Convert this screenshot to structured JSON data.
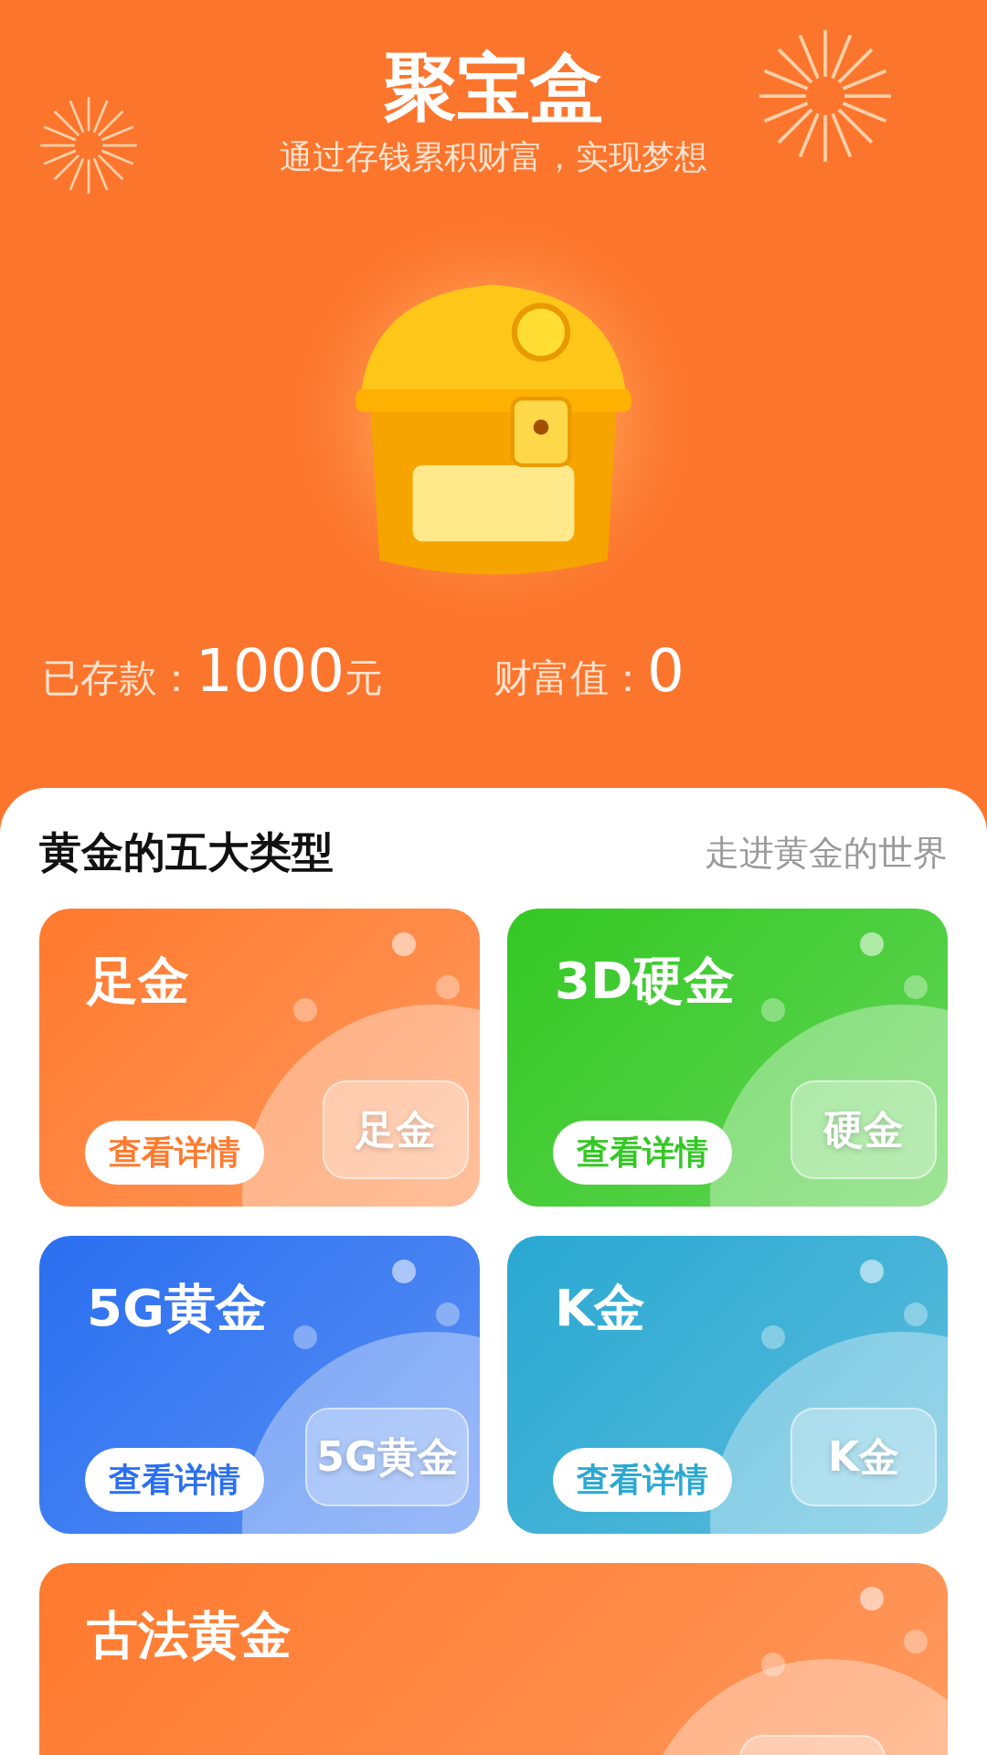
{
  "header": {
    "title": "聚宝盒",
    "subtitle": "通过存钱累积财富，实现梦想"
  },
  "stats": [
    {
      "label": "已存款：",
      "value": "1000",
      "unit": "元"
    },
    {
      "label": "财富值：",
      "value": "0"
    }
  ],
  "section": {
    "title": "黄金的五大类型",
    "link": "走进黄金的世界"
  },
  "cards": [
    {
      "title": "足金",
      "button": "查看详情",
      "badge": "足金",
      "color": "#ff7a2e"
    },
    {
      "title": "3D硬金",
      "button": "查看详情",
      "badge": "硬金",
      "color": "#34c824"
    },
    {
      "title": "5G黄金",
      "button": "查看详情",
      "badge": "5G黄金",
      "color": "#2a6ff0"
    },
    {
      "title": "K金",
      "button": "查看详情",
      "badge": "K金",
      "color": "#2aa8d2"
    },
    {
      "title": "古法黄金",
      "color": "#ff7a2e",
      "wide": true
    }
  ]
}
